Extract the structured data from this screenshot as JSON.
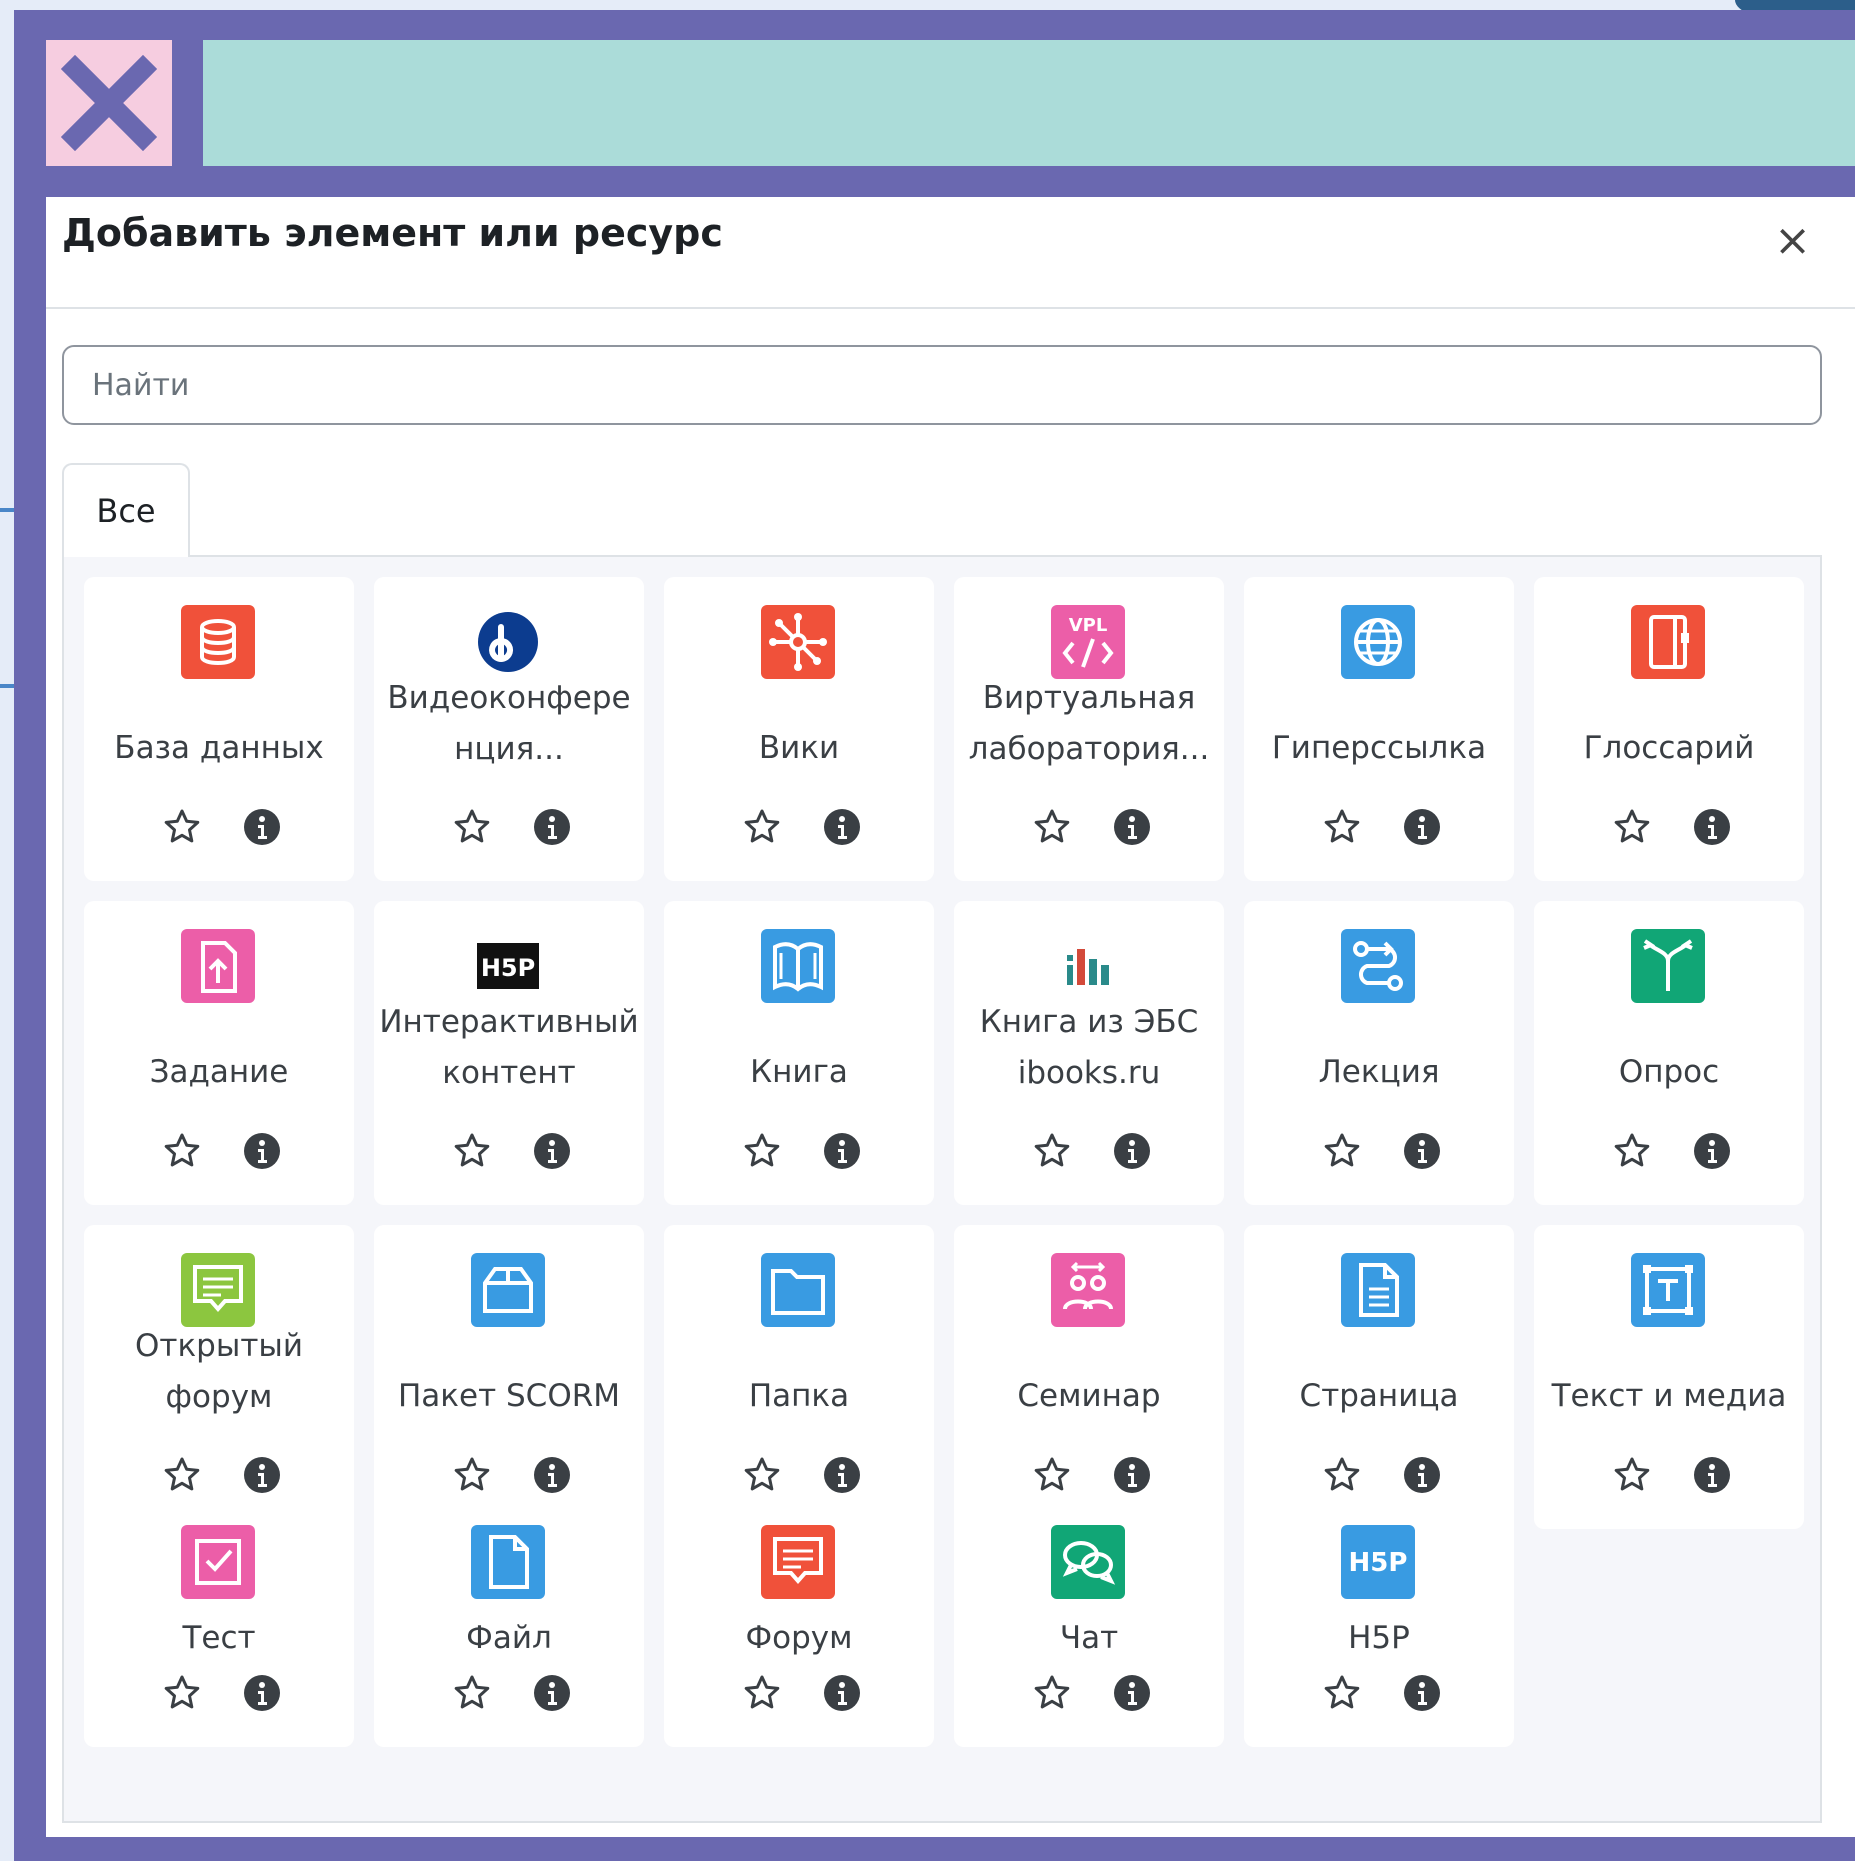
{
  "dialog": {
    "title": "Добавить элемент или ресурс",
    "close_glyph": "×",
    "search_placeholder": "Найти",
    "tab_all": "Все"
  },
  "items": [
    {
      "label": "База данных",
      "icon": "database-icon",
      "color": "#f0513a",
      "bg": "#f0513a"
    },
    {
      "label": "Видеоконфере нция...",
      "icon": "bigbluebutton-icon",
      "color": "#0c3c8f",
      "bg": "#ffffff"
    },
    {
      "label": "Вики",
      "icon": "wiki-icon",
      "color": "#f0513a",
      "bg": "#f0513a"
    },
    {
      "label": "Виртуальная лаборатория...",
      "icon": "vpl-icon",
      "color": "#ec5ea8",
      "bg": "#ec5ea8"
    },
    {
      "label": "Гиперссылка",
      "icon": "globe-icon",
      "color": "#399be2",
      "bg": "#399be2"
    },
    {
      "label": "Глоссарий",
      "icon": "glossary-icon",
      "color": "#f0513a",
      "bg": "#f0513a"
    },
    {
      "label": "Задание",
      "icon": "assignment-icon",
      "color": "#ec5ea8",
      "bg": "#ec5ea8"
    },
    {
      "label": "Интерактивный контент",
      "icon": "h5p-black-icon",
      "color": "#111111",
      "bg": "#ffffff"
    },
    {
      "label": "Книга",
      "icon": "book-icon",
      "color": "#399be2",
      "bg": "#399be2"
    },
    {
      "label": "Книга из ЭБС ibooks.ru",
      "icon": "ibooks-icon",
      "color": "#2a8a8a",
      "bg": "#ffffff"
    },
    {
      "label": "Лекция",
      "icon": "lesson-icon",
      "color": "#399be2",
      "bg": "#399be2"
    },
    {
      "label": "Опрос",
      "icon": "choice-icon",
      "color": "#11a676",
      "bg": "#11a676"
    },
    {
      "label": "Открытый форум",
      "icon": "open-forum-icon",
      "color": "#8cc63f",
      "bg": "#8cc63f"
    },
    {
      "label": "Пакет SCORM",
      "icon": "scorm-icon",
      "color": "#399be2",
      "bg": "#399be2"
    },
    {
      "label": "Папка",
      "icon": "folder-icon",
      "color": "#399be2",
      "bg": "#399be2"
    },
    {
      "label": "Семинар",
      "icon": "workshop-icon",
      "color": "#ec5ea8",
      "bg": "#ec5ea8"
    },
    {
      "label": "Страница",
      "icon": "page-icon",
      "color": "#399be2",
      "bg": "#399be2"
    },
    {
      "label": "Текст и медиа",
      "icon": "text-media-icon",
      "color": "#399be2",
      "bg": "#399be2"
    },
    {
      "label": "Тест",
      "icon": "quiz-icon",
      "color": "#ec5ea8",
      "bg": "#ec5ea8"
    },
    {
      "label": "Файл",
      "icon": "file-icon",
      "color": "#399be2",
      "bg": "#399be2"
    },
    {
      "label": "Форум",
      "icon": "forum-icon",
      "color": "#f0513a",
      "bg": "#f0513a"
    },
    {
      "label": "Чат",
      "icon": "chat-icon",
      "color": "#11a676",
      "bg": "#11a676"
    },
    {
      "label": "H5P",
      "icon": "h5p-icon",
      "color": "#399be2",
      "bg": "#399be2"
    }
  ]
}
